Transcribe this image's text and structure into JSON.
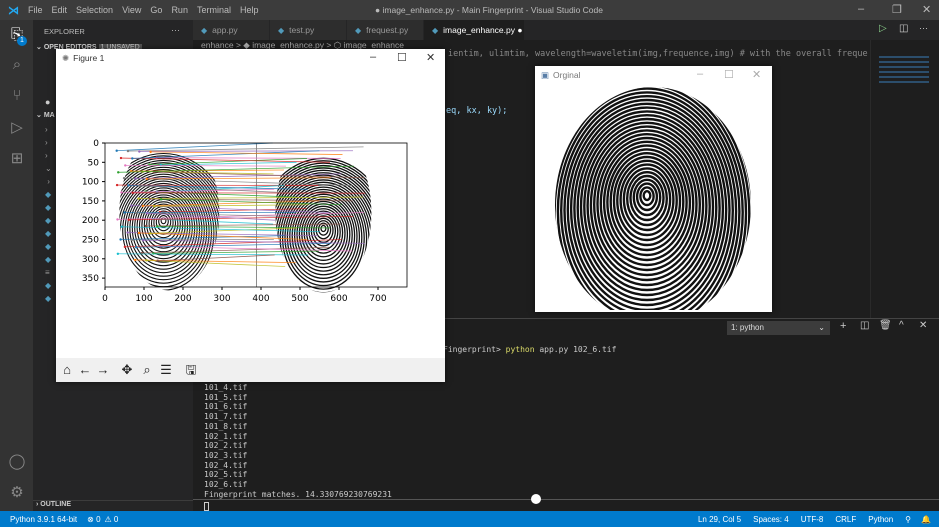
{
  "titlebar": {
    "menu": [
      "File",
      "Edit",
      "Selection",
      "View",
      "Go",
      "Run",
      "Terminal",
      "Help"
    ],
    "title": "● image_enhance.py - Main Fingerprint - Visual Studio Code"
  },
  "activity": {
    "badge": "1"
  },
  "sidebar": {
    "header": "EXPLORER",
    "more": "···",
    "open_editors": "OPEN EDITORS",
    "unsaved": "1 UNSAVED",
    "section": "MA",
    "outline": "OUTLINE"
  },
  "tabs": [
    {
      "label": "app.py"
    },
    {
      "label": "test.py"
    },
    {
      "label": "frequest.py"
    },
    {
      "label": "image_enhance.py",
      "dirty": "●"
    }
  ],
  "breadcrumb": "enhance > ◆ image_enhance.py > ⬡ image_enhance",
  "code": {
    "line1": "ientim, ulimtim, wavelength=waveletim(img,frequence,img)   # with the overall frequency ...",
    "line2": "eq, kx, ky);"
  },
  "figure": {
    "title": "Figure 1",
    "yticks": [
      "0",
      "50",
      "100",
      "150",
      "200",
      "250",
      "300",
      "350"
    ],
    "xticks": [
      "0",
      "100",
      "200",
      "300",
      "400",
      "500",
      "600",
      "700"
    ]
  },
  "original": {
    "title": "Orginal"
  },
  "terminal": {
    "selector": "1: python",
    "prompt": "Fingerprint>",
    "command": "python",
    "args": "app.py 102_6.tif",
    "lines": [
      "101_4.tif",
      "101_5.tif",
      "101_6.tif",
      "101_7.tif",
      "101_8.tif",
      "102_1.tif",
      "102_2.tif",
      "102_3.tif",
      "102_4.tif",
      "102_5.tif",
      "102_6.tif",
      "Fingerprint matches. 14.330769230769231"
    ]
  },
  "statusbar": {
    "python": "Python 3.9.1 64-bit",
    "errors": "⊗ 0",
    "warnings": "⚠ 0",
    "position": "Ln 29, Col 5",
    "spaces": "Spaces: 4",
    "encoding": "UTF-8",
    "eol": "CRLF",
    "language": "Python"
  }
}
